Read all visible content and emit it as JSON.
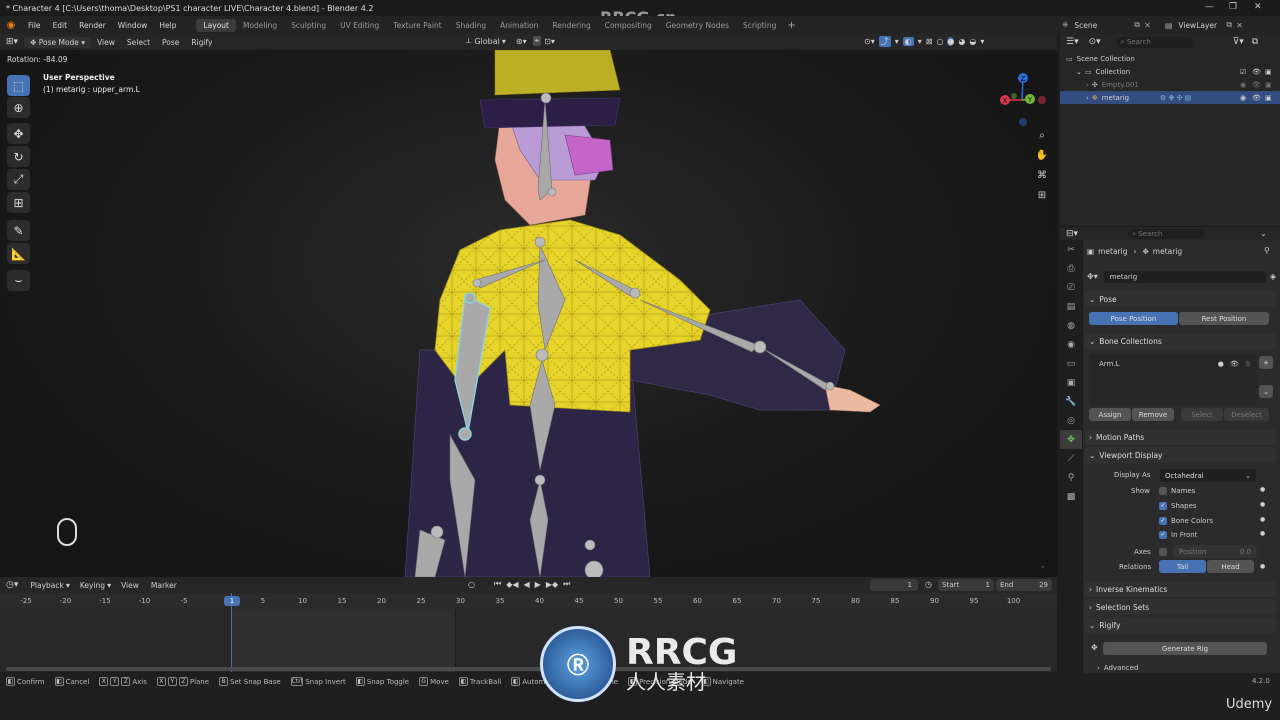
{
  "window": {
    "title": "* Character 4 [C:\\Users\\thoma\\Desktop\\PS1 character LIVE\\Character 4.blend] - Blender 4.2",
    "watermark_top": "RRCG.cn"
  },
  "menu": {
    "items": [
      "File",
      "Edit",
      "Render",
      "Window",
      "Help"
    ],
    "workspaces": [
      "Layout",
      "Modeling",
      "Sculpting",
      "UV Editing",
      "Texture Paint",
      "Shading",
      "Animation",
      "Rendering",
      "Compositing",
      "Geometry Nodes",
      "Scripting"
    ],
    "active_workspace": "Layout",
    "scene": "Scene",
    "view_layer": "ViewLayer"
  },
  "viewport_header": {
    "mode": "Pose Mode",
    "menus": [
      "View",
      "Select",
      "Pose",
      "Rigify"
    ],
    "orientation": "Global"
  },
  "viewport": {
    "rotation": "Rotation: -84.09",
    "perspective": "User Perspective",
    "active": "(1) metarig : upper_arm.L",
    "gizmo_axes": [
      "X",
      "Y",
      "Z"
    ]
  },
  "timeline": {
    "menus": [
      "Playback",
      "Keying",
      "View",
      "Marker"
    ],
    "current_frame": "1",
    "start_label": "Start",
    "start": "1",
    "end_label": "End",
    "end": "29",
    "ticks": [
      "-25",
      "-20",
      "-15",
      "-10",
      "-5",
      "1",
      "5",
      "10",
      "15",
      "20",
      "25",
      "30",
      "35",
      "40",
      "45",
      "50",
      "55",
      "60",
      "65",
      "70",
      "75",
      "80",
      "85",
      "90",
      "95",
      "100"
    ]
  },
  "statusbar": {
    "items": [
      {
        "keys": [],
        "label": "Confirm"
      },
      {
        "keys": [],
        "label": "Cancel"
      },
      {
        "keys": [
          "X",
          "Y",
          "Z"
        ],
        "label": "Axis"
      },
      {
        "keys": [
          "X",
          "Y",
          "Z"
        ],
        "label": "Plane"
      },
      {
        "keys": [
          "B"
        ],
        "label": "Set Snap Base"
      },
      {
        "keys": [
          "Ctrl"
        ],
        "label": "Snap Invert"
      },
      {
        "keys": [],
        "label": "Snap Toggle"
      },
      {
        "keys": [
          "G"
        ],
        "label": "Move"
      },
      {
        "keys": [],
        "label": "TrackBall"
      },
      {
        "keys": [],
        "label": "Automatic Constraint Plane"
      },
      {
        "keys": [],
        "label": "Precision Mode"
      },
      {
        "keys": [],
        "label": "Navigate"
      }
    ],
    "version": "4.2.0",
    "brand": "Udemy",
    "watermark": "RRCG",
    "watermark_sub": "人人素材"
  },
  "outliner": {
    "search_placeholder": "Search",
    "rows": [
      {
        "label": "Scene Collection",
        "indent": 0
      },
      {
        "label": "Collection",
        "indent": 1
      },
      {
        "label": "Empty.001",
        "indent": 2
      },
      {
        "label": "metarig",
        "indent": 2,
        "selected": true
      }
    ]
  },
  "properties": {
    "search_placeholder": "Search",
    "breadcrumb": [
      "metarig",
      "metarig"
    ],
    "name": "metarig",
    "pose": {
      "title": "Pose",
      "pose_position": "Pose Position",
      "rest_position": "Rest Position"
    },
    "bone_collections": {
      "title": "Bone Collections",
      "items": [
        "Arm.L"
      ],
      "assign": "Assign",
      "remove": "Remove",
      "select": "Select",
      "deselect": "Deselect"
    },
    "motion_paths": "Motion Paths",
    "viewport_display": {
      "title": "Viewport Display",
      "display_as_label": "Display As",
      "display_as": "Octahedral",
      "show_label": "Show",
      "names": "Names",
      "shapes": "Shapes",
      "bone_colors": "Bone Colors",
      "in_front": "In Front",
      "axes_label": "Axes",
      "position_label": "Position",
      "position": "0.0",
      "relations_label": "Relations",
      "tail": "Tail",
      "head": "Head"
    },
    "inverse_kinematics": "Inverse Kinematics",
    "selection_sets": "Selection Sets",
    "rigify": {
      "title": "Rigify",
      "generate": "Generate Rig",
      "advanced": "Advanced"
    }
  },
  "colors": {
    "accent": "#4772b3",
    "jacket": "#e8d52a",
    "pants": "#2f2748",
    "bone": "#a9a9a9",
    "selected_bone": "#8fd3de"
  }
}
